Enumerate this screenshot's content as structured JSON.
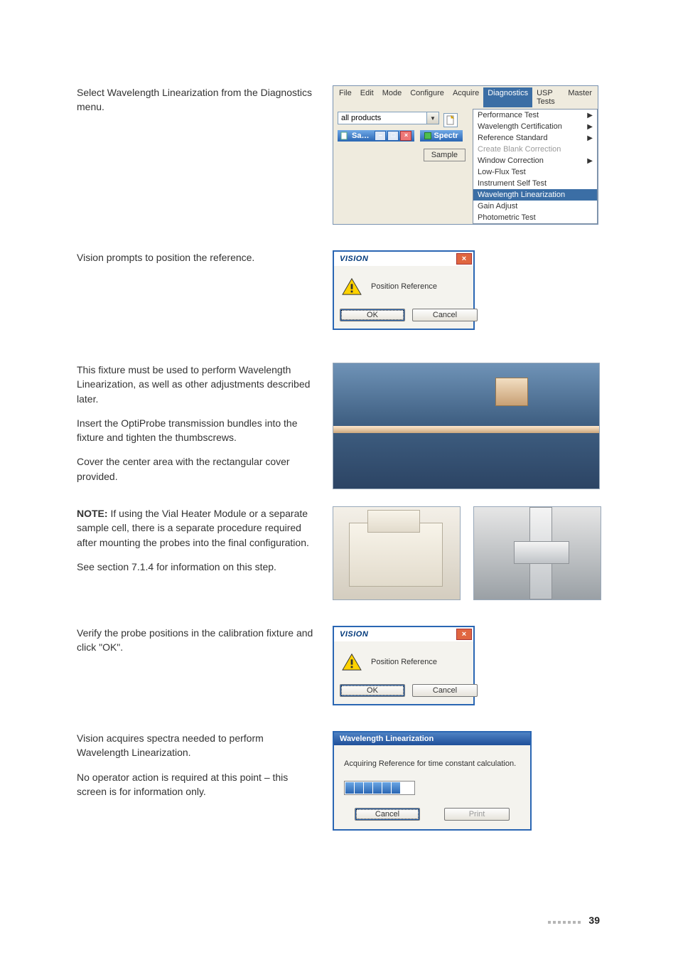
{
  "paragraphs": {
    "p1": "Select Wavelength Linearization from the Diagnostics menu.",
    "p2": "Vision prompts to position the reference.",
    "p3": "This fixture must be used to perform Wavelength Linearization, as well as other adjustments described later.",
    "p4": "Insert the OptiProbe transmission bundles into the fixture and tighten the thumbscrews.",
    "p5": "Cover the center area with the rectangular cover provided.",
    "note_label": "NOTE:",
    "p6": " If using the Vial Heater Module or a separate sample cell, there is a separate procedure required after mounting the probes into the final configuration.",
    "p7": "See section 7.1.4 for information on this step.",
    "p8": "Verify the probe positions in the calibration fixture and click \"OK\".",
    "p9": "Vision acquires spectra needed to perform Wavelength Linearization.",
    "p10": "No operator action is required at this point – this screen is for information only."
  },
  "menubar": {
    "items": [
      "File",
      "Edit",
      "Mode",
      "Configure",
      "Acquire",
      "Diagnostics",
      "USP Tests",
      "Master"
    ],
    "active_index": 5
  },
  "toolbar": {
    "combo_value": "all products",
    "sa_window_title": "Sa…",
    "spectra_tab": "Spectr",
    "sample_button": "Sample"
  },
  "diag_menu": {
    "items": [
      {
        "label": "Performance Test",
        "has_submenu": true,
        "disabled": false
      },
      {
        "label": "Wavelength Certification",
        "has_submenu": true,
        "disabled": false
      },
      {
        "label": "Reference Standard",
        "has_submenu": true,
        "disabled": false
      },
      {
        "label": "Create Blank Correction",
        "has_submenu": false,
        "disabled": true
      },
      {
        "label": "Window Correction",
        "has_submenu": true,
        "disabled": false
      },
      {
        "label": "Low-Flux Test",
        "has_submenu": false,
        "disabled": false
      },
      {
        "label": "Instrument Self Test",
        "has_submenu": false,
        "disabled": false
      },
      {
        "label": "Wavelength Linearization",
        "has_submenu": false,
        "disabled": false,
        "selected": true
      },
      {
        "label": "Gain Adjust",
        "has_submenu": false,
        "disabled": false
      },
      {
        "label": "Photometric Test",
        "has_submenu": false,
        "disabled": false
      }
    ]
  },
  "vision_dialog": {
    "title": "VISION",
    "message": "Position Reference",
    "ok": "OK",
    "cancel": "Cancel"
  },
  "wl_dialog": {
    "title": "Wavelength Linearization",
    "message": "Acquiring Reference for time constant calculation.",
    "cancel": "Cancel",
    "print": "Print"
  },
  "page_number": "39"
}
